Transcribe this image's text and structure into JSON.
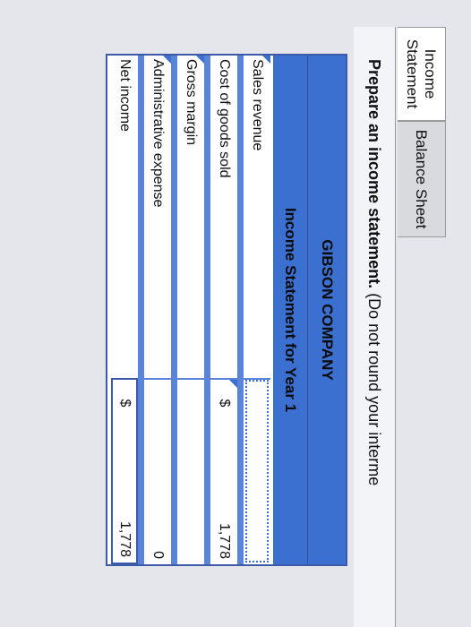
{
  "tabs": {
    "income_line1": "Income",
    "income_line2": "Statement",
    "balance": "Balance Sheet"
  },
  "instruction": {
    "bold": "Prepare an income statement.",
    "rest": " (Do not round your interme"
  },
  "statement": {
    "company": "GIBSON COMPANY",
    "title": "Income Statement for Year 1",
    "rows": [
      {
        "label": "Sales revenue",
        "currency": "",
        "amount": ""
      },
      {
        "label": "Cost of goods sold",
        "currency": "$",
        "amount": "1,778"
      },
      {
        "label": "Gross margin",
        "currency": "",
        "amount": ""
      },
      {
        "label": "Administrative expense",
        "currency": "",
        "amount": "0"
      },
      {
        "label": "Net income",
        "currency": "$",
        "amount": "1,778"
      }
    ]
  }
}
